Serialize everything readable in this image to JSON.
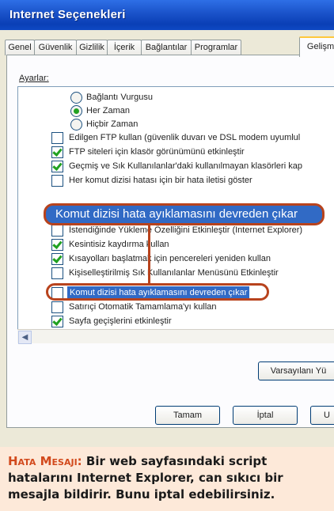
{
  "window": {
    "title": "Internet Seçenekleri"
  },
  "tabs": [
    "Genel",
    "Güvenlik",
    "Gizlilik",
    "İçerik",
    "Bağlantılar",
    "Programlar",
    "Gelişmiş"
  ],
  "settings_label": "Ayarlar:",
  "items": [
    {
      "kind": "radio",
      "checked": false,
      "label": "Bağlantı Vurgusu"
    },
    {
      "kind": "radio",
      "checked": true,
      "label": "Her Zaman"
    },
    {
      "kind": "radio",
      "checked": false,
      "label": "Hiçbir Zaman"
    },
    {
      "kind": "check",
      "checked": false,
      "label": "Edilgen FTP kullan (güvenlik duvarı ve DSL modem uyumlul"
    },
    {
      "kind": "check",
      "checked": true,
      "label": "FTP siteleri için klasör görünümünü etkinleştir"
    },
    {
      "kind": "check",
      "checked": true,
      "label": "Geçmiş ve Sık Kullanılanlar'daki kullanılmayan klasörleri kap"
    },
    {
      "kind": "check",
      "checked": false,
      "label": "Her komut dizisi hatası için bir hata iletisi göster"
    },
    {
      "kind": "check",
      "checked": false,
      "label": "İstendiğinde Yükleme Özelliğini Etkinleştir (Internet Explorer)"
    },
    {
      "kind": "check",
      "checked": true,
      "label": "Kesintisiz kaydırma kullan"
    },
    {
      "kind": "check",
      "checked": true,
      "label": "Kısayolları başlatmak için pencereleri yeniden kullan"
    },
    {
      "kind": "check",
      "checked": false,
      "label": "Kişiselleştirilmiş Sık Kullanılanlar Menüsünü Etkinleştir"
    },
    {
      "kind": "check",
      "checked": false,
      "selected": true,
      "label": "Komut dizisi hata ayıklamasını devreden çıkar"
    },
    {
      "kind": "check",
      "checked": false,
      "label": "Satırıçi Otomatik Tamamlama'yı kullan"
    },
    {
      "kind": "check",
      "checked": true,
      "label": "Sayfa geçişlerini etkinleştir"
    }
  ],
  "callout": {
    "text": "Komut dizisi hata ayıklamasını devreden çıkar"
  },
  "buttons": {
    "restore_defaults": "Varsayılanı Yü",
    "ok": "Tamam",
    "cancel": "İptal",
    "apply": "U"
  },
  "caption": {
    "heading": "Hata Mesajı:",
    "body": "Bir web sayfasındaki script hatalarını Internet Explorer, can sıkıcı bir mesajla bildirir. Bunu iptal edebilirsiniz."
  },
  "colors": {
    "highlight": "#b8431d",
    "selection": "#316ac5",
    "caption_heading": "#d24a1d",
    "caption_bg": "#fde9d9"
  }
}
